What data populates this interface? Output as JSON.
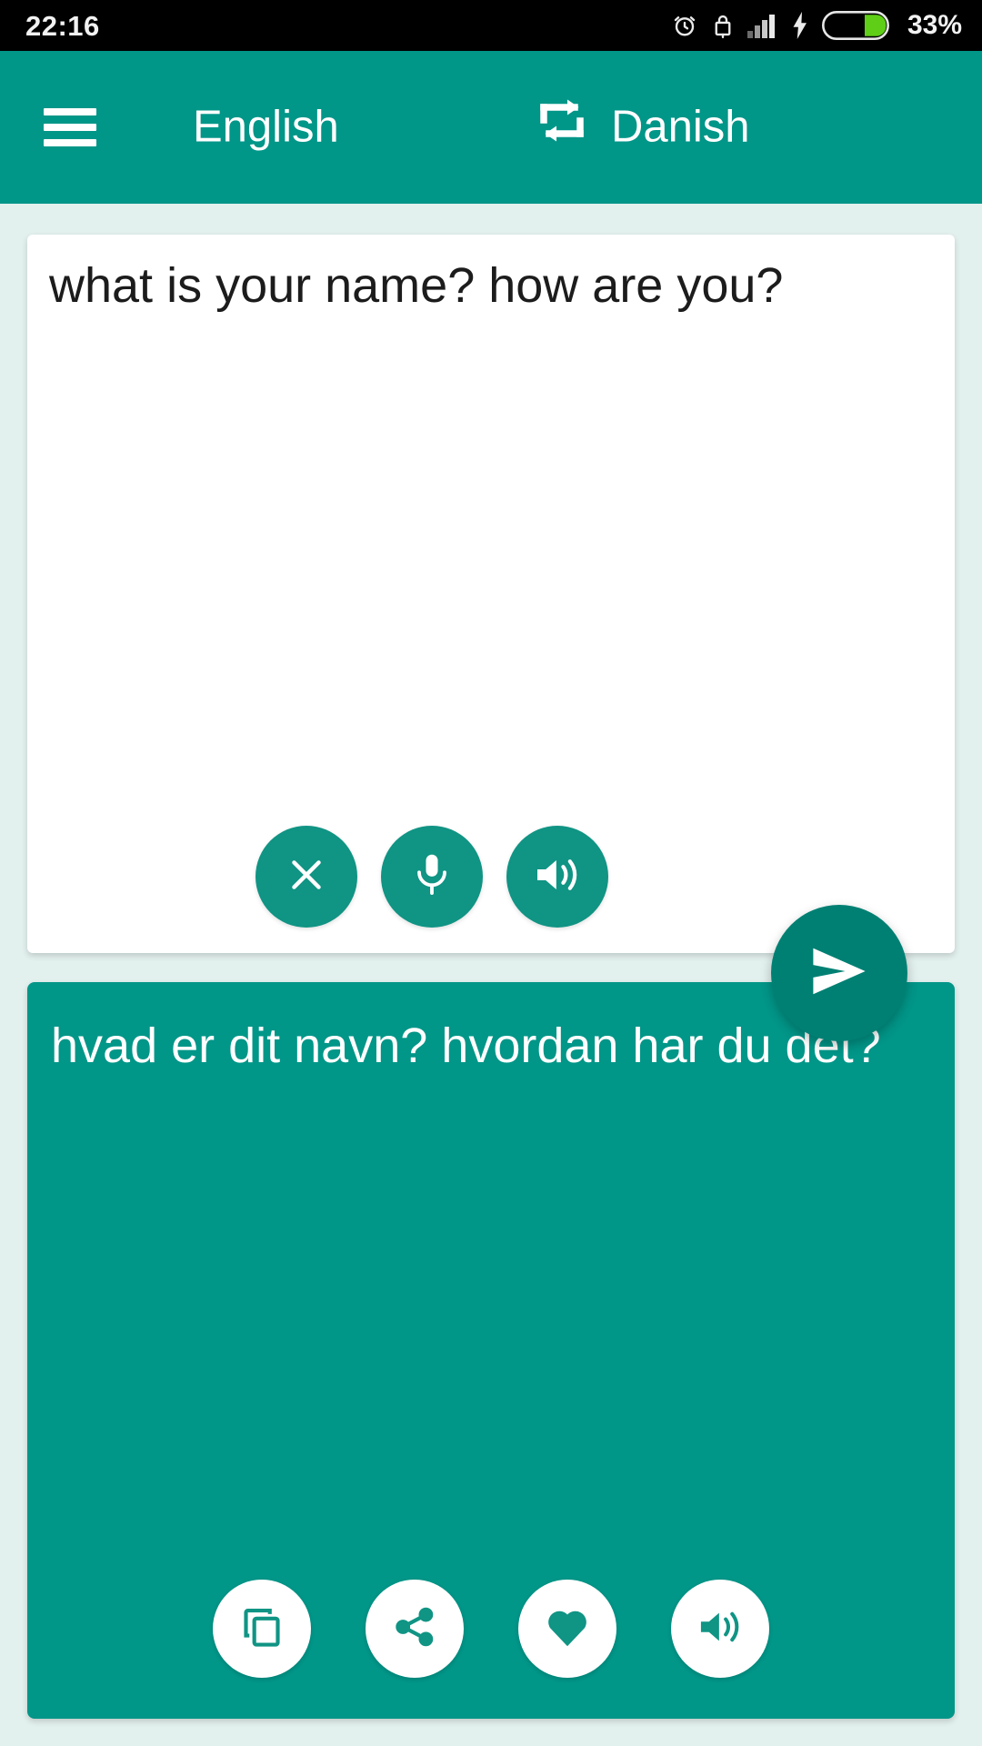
{
  "status_bar": {
    "time": "22:16",
    "battery_percent": "33%",
    "icons": [
      "alarm-icon",
      "lock-icon",
      "signal-icon",
      "charging-bolt-icon",
      "battery-icon"
    ]
  },
  "toolbar": {
    "menu_icon": "hamburger-menu-icon",
    "source_language": "English",
    "swap_icon": "swap-languages-icon",
    "target_language": "Danish",
    "background_color": "#009688"
  },
  "source_card": {
    "text": "what is your name? how are you?",
    "placeholder": "",
    "background_color": "#ffffff",
    "actions": [
      {
        "name": "clear-button",
        "icon": "close-icon",
        "label": "Clear"
      },
      {
        "name": "voice-input-button",
        "icon": "microphone-icon",
        "label": "Speak"
      },
      {
        "name": "speak-source-button",
        "icon": "speaker-icon",
        "label": "Listen"
      }
    ]
  },
  "send_button": {
    "icon": "send-icon",
    "label": "Translate",
    "color": "#008073"
  },
  "target_card": {
    "text": "hvad er dit navn? hvordan har du det?",
    "background_color": "#009688",
    "actions": [
      {
        "name": "copy-button",
        "icon": "copy-icon",
        "label": "Copy"
      },
      {
        "name": "share-button",
        "icon": "share-icon",
        "label": "Share"
      },
      {
        "name": "favorite-button",
        "icon": "heart-icon",
        "label": "Favorite"
      },
      {
        "name": "speak-target-button",
        "icon": "speaker-icon",
        "label": "Listen"
      }
    ]
  },
  "colors": {
    "accent": "#009688",
    "accent_dark": "#008073",
    "page_background": "#e2f0ee"
  }
}
